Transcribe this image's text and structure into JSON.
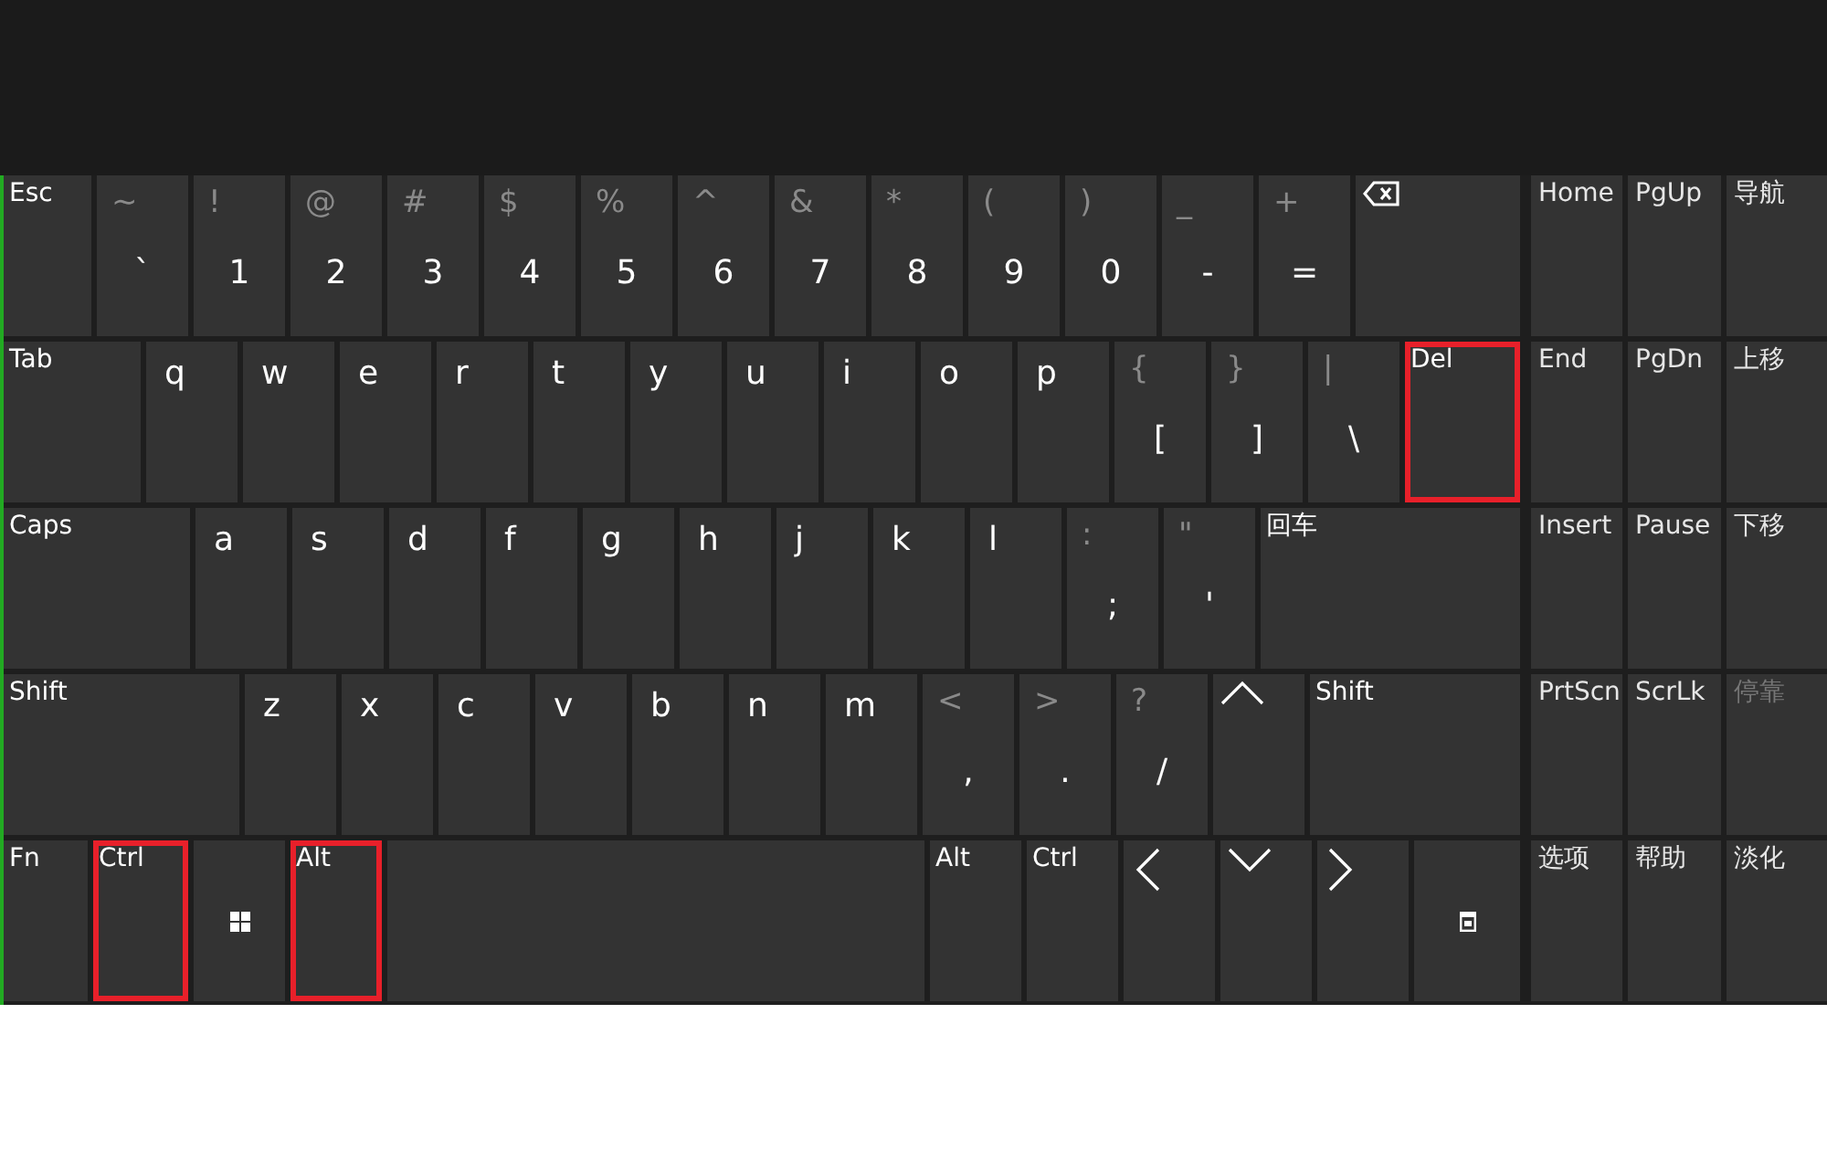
{
  "keyboard": {
    "rows": [
      {
        "keys": [
          {
            "kind": "label",
            "label": "Esc",
            "highlighted": false
          },
          {
            "kind": "char",
            "shift": "~",
            "label": "`",
            "highlighted": false
          },
          {
            "kind": "char",
            "shift": "!",
            "label": "1",
            "highlighted": false
          },
          {
            "kind": "char",
            "shift": "@",
            "label": "2",
            "highlighted": false
          },
          {
            "kind": "char",
            "shift": "#",
            "label": "3",
            "highlighted": false
          },
          {
            "kind": "char",
            "shift": "$",
            "label": "4",
            "highlighted": false
          },
          {
            "kind": "char",
            "shift": "%",
            "label": "5",
            "highlighted": false
          },
          {
            "kind": "char",
            "shift": "^",
            "label": "6",
            "highlighted": false
          },
          {
            "kind": "char",
            "shift": "&",
            "label": "7",
            "highlighted": false
          },
          {
            "kind": "char",
            "shift": "*",
            "label": "8",
            "highlighted": false
          },
          {
            "kind": "char",
            "shift": "(",
            "label": "9",
            "highlighted": false
          },
          {
            "kind": "char",
            "shift": ")",
            "label": "0",
            "highlighted": false
          },
          {
            "kind": "char",
            "shift": "_",
            "label": "-",
            "highlighted": false
          },
          {
            "kind": "char",
            "shift": "+",
            "label": "=",
            "highlighted": false
          },
          {
            "kind": "backspace",
            "highlighted": false
          }
        ]
      },
      {
        "keys": [
          {
            "kind": "label",
            "label": "Tab",
            "highlighted": false
          },
          {
            "kind": "letter",
            "label": "q",
            "highlighted": false
          },
          {
            "kind": "letter",
            "label": "w",
            "highlighted": false
          },
          {
            "kind": "letter",
            "label": "e",
            "highlighted": false
          },
          {
            "kind": "letter",
            "label": "r",
            "highlighted": false
          },
          {
            "kind": "letter",
            "label": "t",
            "highlighted": false
          },
          {
            "kind": "letter",
            "label": "y",
            "highlighted": false
          },
          {
            "kind": "letter",
            "label": "u",
            "highlighted": false
          },
          {
            "kind": "letter",
            "label": "i",
            "highlighted": false
          },
          {
            "kind": "letter",
            "label": "o",
            "highlighted": false
          },
          {
            "kind": "letter",
            "label": "p",
            "highlighted": false
          },
          {
            "kind": "char",
            "shift": "{",
            "label": "[",
            "highlighted": false
          },
          {
            "kind": "char",
            "shift": "}",
            "label": "]",
            "highlighted": false
          },
          {
            "kind": "char",
            "shift": "|",
            "label": "\\",
            "highlighted": false
          },
          {
            "kind": "label",
            "label": "Del",
            "highlighted": true
          }
        ]
      },
      {
        "keys": [
          {
            "kind": "label",
            "label": "Caps",
            "highlighted": false
          },
          {
            "kind": "letter",
            "label": "a",
            "highlighted": false
          },
          {
            "kind": "letter",
            "label": "s",
            "highlighted": false
          },
          {
            "kind": "letter",
            "label": "d",
            "highlighted": false
          },
          {
            "kind": "letter",
            "label": "f",
            "highlighted": false
          },
          {
            "kind": "letter",
            "label": "g",
            "highlighted": false
          },
          {
            "kind": "letter",
            "label": "h",
            "highlighted": false
          },
          {
            "kind": "letter",
            "label": "j",
            "highlighted": false
          },
          {
            "kind": "letter",
            "label": "k",
            "highlighted": false
          },
          {
            "kind": "letter",
            "label": "l",
            "highlighted": false
          },
          {
            "kind": "char",
            "shift": ":",
            "label": ";",
            "highlighted": false
          },
          {
            "kind": "char",
            "shift": "\"",
            "label": "'",
            "highlighted": false
          },
          {
            "kind": "label",
            "label": "回车",
            "highlighted": false
          }
        ]
      },
      {
        "keys": [
          {
            "kind": "label",
            "label": "Shift",
            "highlighted": false
          },
          {
            "kind": "letter",
            "label": "z",
            "highlighted": false
          },
          {
            "kind": "letter",
            "label": "x",
            "highlighted": false
          },
          {
            "kind": "letter",
            "label": "c",
            "highlighted": false
          },
          {
            "kind": "letter",
            "label": "v",
            "highlighted": false
          },
          {
            "kind": "letter",
            "label": "b",
            "highlighted": false
          },
          {
            "kind": "letter",
            "label": "n",
            "highlighted": false
          },
          {
            "kind": "letter",
            "label": "m",
            "highlighted": false
          },
          {
            "kind": "char",
            "shift": "<",
            "label": ",",
            "highlighted": false
          },
          {
            "kind": "char",
            "shift": ">",
            "label": ".",
            "highlighted": false
          },
          {
            "kind": "char",
            "shift": "?",
            "label": "/",
            "highlighted": false
          },
          {
            "kind": "up",
            "highlighted": false
          },
          {
            "kind": "label",
            "label": "Shift",
            "highlighted": false
          }
        ]
      },
      {
        "keys": [
          {
            "kind": "label",
            "label": "Fn",
            "highlighted": false
          },
          {
            "kind": "label",
            "label": "Ctrl",
            "highlighted": true
          },
          {
            "kind": "windows",
            "highlighted": false
          },
          {
            "kind": "label",
            "label": "Alt",
            "highlighted": true
          },
          {
            "kind": "blank",
            "highlighted": false
          },
          {
            "kind": "label",
            "label": "Alt",
            "highlighted": false
          },
          {
            "kind": "label",
            "label": "Ctrl",
            "highlighted": false
          },
          {
            "kind": "left",
            "highlighted": false
          },
          {
            "kind": "down",
            "highlighted": false
          },
          {
            "kind": "right",
            "highlighted": false
          },
          {
            "kind": "menu",
            "highlighted": false
          }
        ]
      }
    ]
  },
  "side_panel": {
    "rows": [
      {
        "keys": [
          {
            "label": "Home",
            "disabled": false
          },
          {
            "label": "PgUp",
            "disabled": false
          },
          {
            "label": "导航",
            "disabled": false
          }
        ]
      },
      {
        "keys": [
          {
            "label": "End",
            "disabled": false
          },
          {
            "label": "PgDn",
            "disabled": false
          },
          {
            "label": "上移",
            "disabled": false
          }
        ]
      },
      {
        "keys": [
          {
            "label": "Insert",
            "disabled": false
          },
          {
            "label": "Pause",
            "disabled": false
          },
          {
            "label": "下移",
            "disabled": false
          }
        ]
      },
      {
        "keys": [
          {
            "label": "PrtScn",
            "disabled": false
          },
          {
            "label": "ScrLk",
            "disabled": false
          },
          {
            "label": "停靠",
            "disabled": true
          }
        ]
      },
      {
        "keys": [
          {
            "label": "选项",
            "disabled": false
          },
          {
            "label": "帮助",
            "disabled": false
          },
          {
            "label": "淡化",
            "disabled": false
          }
        ]
      }
    ]
  }
}
